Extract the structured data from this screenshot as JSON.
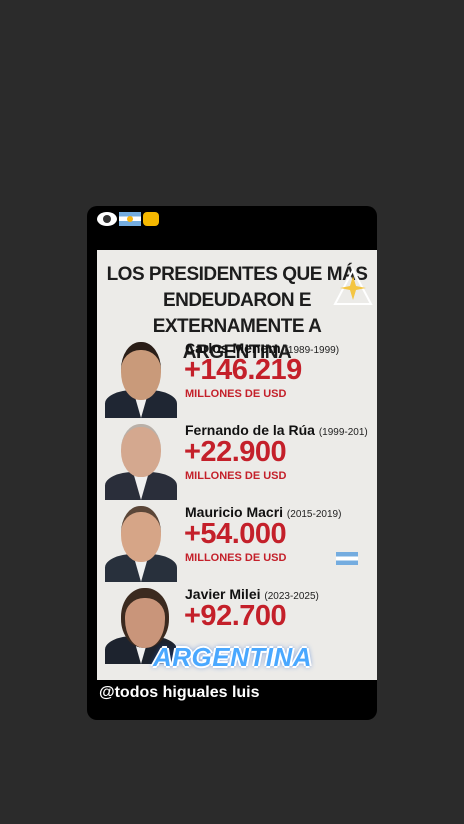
{
  "story": {
    "emojis": [
      "eye-icon",
      "argentina-flag-icon",
      "fist-icon"
    ],
    "poster": {
      "title_lines": [
        "LOS PRESIDENTES QUE MÁS",
        "ENDEUDARON E",
        "EXTERNAMENTE A ARGENTINA"
      ],
      "presidents": [
        {
          "name": "Carlos Menem",
          "years": "(1989-1999)",
          "amount": "+146.219",
          "units": "MILLONES DE USD"
        },
        {
          "name": "Fernando de la Rúa",
          "years": "(1999-201)",
          "amount": "+22.900",
          "units": "MILLONES DE USD"
        },
        {
          "name": "Mauricio Macri",
          "years": "(2015-2019)",
          "amount": "+54.000",
          "units": "MILLONES DE USD"
        },
        {
          "name": "Javier Milei",
          "years": "(2023-2025)",
          "amount": "+92.700",
          "units": ""
        }
      ]
    },
    "overlay_text": "ARGENTINA",
    "caption": "@todos higuales luis"
  }
}
